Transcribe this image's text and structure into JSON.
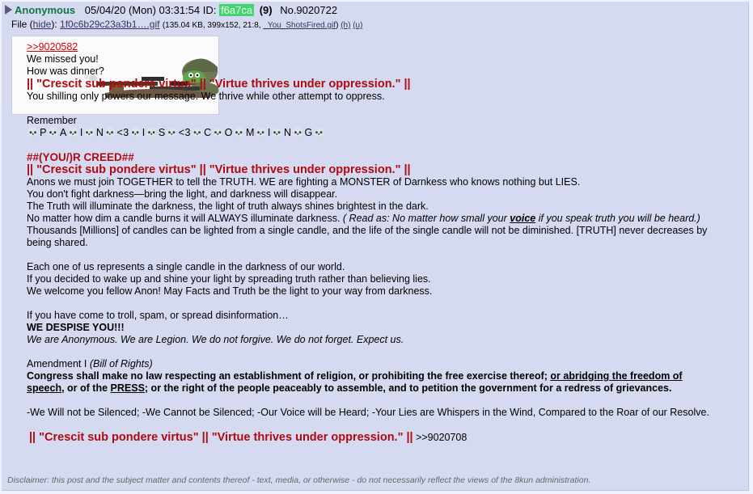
{
  "header": {
    "name": "Anonymous",
    "date": "05/04/20 (Mon) 03:31:54",
    "id_label": "ID:",
    "id_value": "f6a7ca",
    "reply_count": "(9)",
    "post_number": "No.9020722"
  },
  "file": {
    "label": "File (",
    "hide": "hide",
    "sep": "):",
    "filename": "1f0c6b29c23a3b1….gif",
    "meta_open": "(135.04 KB, 399x152, 21:8,",
    "original_name": "_You_ShotsFired.gif",
    "meta_close": ")",
    "link_h": "(h)",
    "link_u": "(u)"
  },
  "post": {
    "quote_link": ">>9020582",
    "line1": "We missed you!",
    "line2": "How was dinner?",
    "motto": "|| \"Crescit sub pondere virtus\" || \"Virtue thrives under oppression.\" ||",
    "line3": "You shilling only powers our message. We thrive while other attempt to oppress.",
    "remember": "Remember",
    "paining": "💀P💀A💀I💀N💀<3💀I💀S💀<3💀C💀O💀M💀I💀N💀G💀",
    "creed": "##(YOU/)R CREED##",
    "motto2": "|| \"Crescit sub pondere virtus\" || \"Virtue thrives under oppression.\" ||",
    "p1": "Anons we must join TOGETHER to tell the TRUTH. WE are fighting a MONSTER of Darnkess who knows nothing but LIES.",
    "p2": "You don't fight darkness—bring the light, and darkness will disappear.",
    "p3": "The Truth will illuminate the darkness, the light of truth always shines brightest in the dark.",
    "p4_a": "No matter how dim a candle burns it will ALWAYS illuminate darkness.",
    "p4_b": "( Read as: No matter how small your",
    "p4_voice": "voice",
    "p4_c": "if you speak truth you will be heard.)",
    "p5": "Thousands [Millions] of candles can be lighted from a single candle, and the life of the single candle will not be diminished. [TRUTH] never decreases by being shared.",
    "p6": "Each one of us represents a single candle in the darkness of our world.",
    "p7": "If you decided to wake up and shine your light by spreading truth rather than believing lies.",
    "p8": "We welcome you fellow Anon! May Facts and Truth be the light to your way from darkness.",
    "p9": "If you have come to troll, spam, or spread disinformation…",
    "p10": "WE DESPISE YOU!!!",
    "p11": "We are Anonymous. We are Legion. We do not forgive. We do not forget. Expect us.",
    "amend": "Amendment I",
    "amend_sub": "(Bill of Rights)",
    "c1": "Congress shall make no law respecting an establishment of religion, or prohibiting the free exercise thereof;",
    "c2": "or abridging the freedom of speech",
    "c3": ", or of the",
    "c4": "PRESS",
    "c5": "; or the right of the people peaceably to assemble, and to petition the government for a redress of grievances.",
    "p12": "-We Will not be Silenced;  -We Cannot be Silenced;  -Our Voice will be Heard;   -Your Lies are Whispers in the Wind, Compared to the Roar of our Resolve.",
    "motto3": "|| \"Crescit sub pondere virtus\" || \"Virtue thrives under oppression.\" ||",
    "end_link": ">>9020708"
  },
  "disclaimer": "Disclaimer: this post and the subject matter and contents thereof - text, media, or otherwise - do not necessarily reflect the views of the 8kun administration.",
  "colors": {
    "name": "#117743",
    "id_bg": "#3fd66b",
    "red_text": "#af0a0f",
    "link": "#34345c",
    "quote": "#dd0000",
    "post_bg": "#d6daf0"
  }
}
